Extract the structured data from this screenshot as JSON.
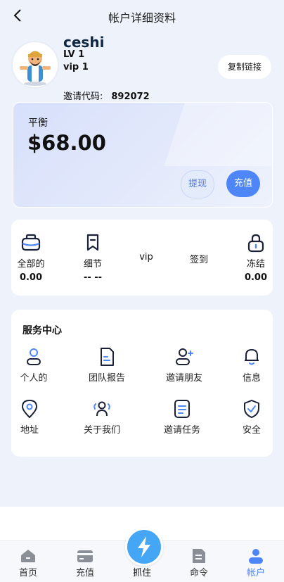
{
  "header": {
    "title": "帐户详细资料"
  },
  "profile": {
    "username": "ceshi",
    "level": "LV 1",
    "vip": "vip 1",
    "copy_link_label": "复制链接",
    "invite_label": "邀请代码:",
    "invite_code": "892072"
  },
  "balance": {
    "label": "平衡",
    "amount": "$68.00",
    "withdraw_label": "提现",
    "recharge_label": "充值"
  },
  "stats": {
    "all": {
      "label": "全部的",
      "value": "0.00"
    },
    "details": {
      "label": "细节",
      "value": "-- --"
    },
    "vip": {
      "label": "vip"
    },
    "checkin": {
      "label": "签到"
    },
    "frozen": {
      "label": "冻结",
      "value": "0.00"
    }
  },
  "services": {
    "title": "服务中心",
    "items": [
      {
        "label": "个人的",
        "icon": "person-icon"
      },
      {
        "label": "团队报告",
        "icon": "document-icon"
      },
      {
        "label": "邀请朋友",
        "icon": "add-user-icon"
      },
      {
        "label": "信息",
        "icon": "bell-icon"
      },
      {
        "label": "地址",
        "icon": "location-icon"
      },
      {
        "label": "关于我们",
        "icon": "group-icon"
      },
      {
        "label": "邀请任务",
        "icon": "task-list-icon"
      },
      {
        "label": "安全",
        "icon": "shield-check-icon"
      }
    ]
  },
  "tabbar": {
    "home": "首页",
    "recharge": "充值",
    "grab": "抓住",
    "orders": "命令",
    "account": "帐户"
  },
  "colors": {
    "accent": "#4f86f7",
    "center_button": "#45a6f5",
    "background": "#eef3fb"
  }
}
